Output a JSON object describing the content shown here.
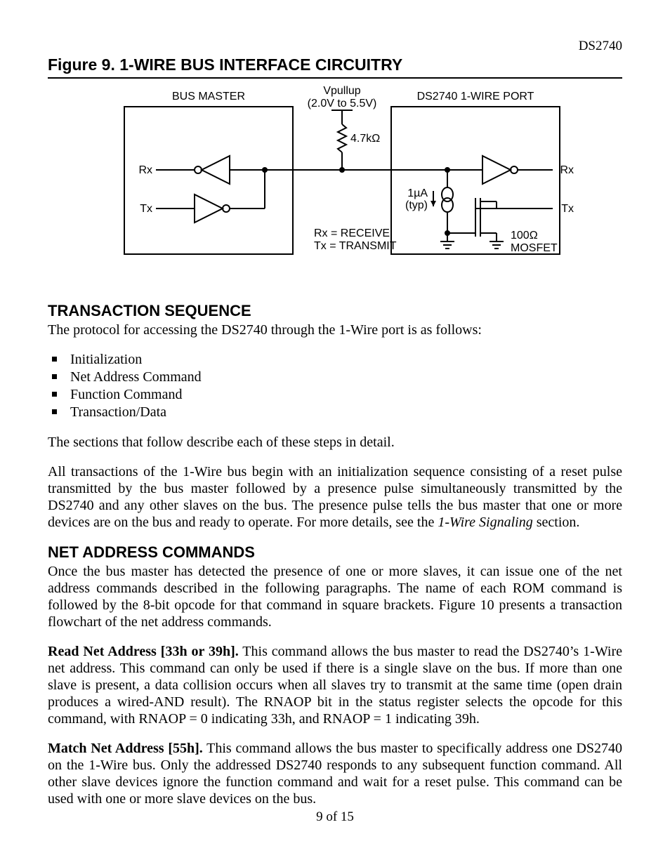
{
  "header": {
    "part": "DS2740"
  },
  "figure": {
    "title": "Figure 9. 1-WIRE BUS INTERFACE CIRCUITRY",
    "bus_master": "BUS MASTER",
    "vpullup1": "Vpullup",
    "vpullup2": "(2.0V to 5.5V)",
    "port": "DS2740 1-WIRE PORT",
    "r_pullup": "4.7kΩ",
    "rx_left": "Rx",
    "tx_left": "Tx",
    "rx_right": "Rx",
    "tx_right": "Tx",
    "ibias1": "1µA",
    "ibias2": "(typ)",
    "legend1": "Rx = RECEIVE",
    "legend2": "Tx = TRANSMIT",
    "mosfet1": "100Ω",
    "mosfet2": "MOSFET"
  },
  "sec1": {
    "head": "TRANSACTION SEQUENCE",
    "intro": "The protocol for accessing the DS2740 through the 1-Wire port is as follows:",
    "items": [
      "Initialization",
      "Net Address Command",
      "Function Command",
      "Transaction/Data"
    ],
    "after": "The sections that follow describe each of these steps in detail.",
    "para": "All transactions of the 1-Wire bus begin with an initialization sequence consisting of a reset pulse transmitted by the bus master followed by a presence pulse simultaneously transmitted by the DS2740 and any other slaves on the bus. The presence pulse tells the bus master that one or more devices are on the bus and ready to operate. For more details, see the ",
    "para_ital": "1-Wire Signaling",
    "para_tail": " section."
  },
  "sec2": {
    "head": "NET ADDRESS COMMANDS",
    "intro": "Once the bus master has detected the presence of one or more slaves, it can issue one of the net address commands described in the following paragraphs. The name of each ROM command is followed by the 8-bit opcode for that command in square brackets. Figure 10 presents a transaction flowchart of the net address commands.",
    "rna_head": "Read Net Address [33h or 39h].",
    "rna_body": " This command allows the bus master to read the DS2740’s 1-Wire net address. This command can only be used if there is a single slave on the bus. If more than one slave is present, a data collision occurs when all slaves try to transmit at the same time (open drain produces a wired-AND result). The RNAOP bit in the status register selects the opcode for this command, with RNAOP = 0 indicating 33h, and RNAOP = 1 indicating 39h.",
    "mna_head": "Match Net Address [55h].",
    "mna_body": " This command allows the bus master to specifically address one DS2740 on the 1-Wire bus. Only the addressed DS2740 responds to any subsequent function command. All other slave devices ignore the function command and wait for a reset pulse. This command can be used with one or more slave devices on the bus."
  },
  "footer": {
    "pagenum": "9 of 15"
  }
}
